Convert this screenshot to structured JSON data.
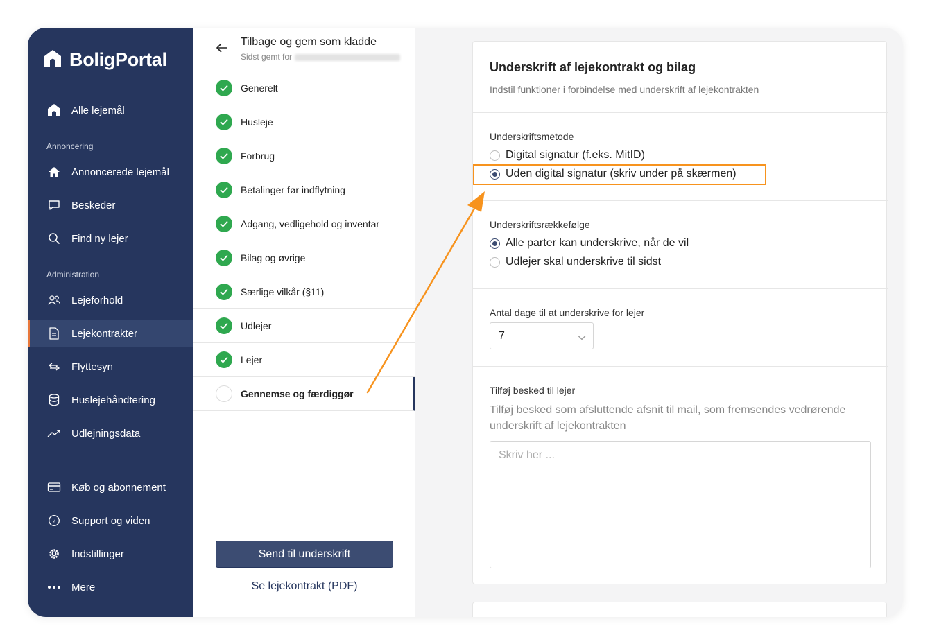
{
  "brand": {
    "name": "BoligPortal"
  },
  "sidebar": {
    "top_item": "Alle lejemål",
    "section_announcing": "Annoncering",
    "announcing_items": [
      "Annoncerede lejemål",
      "Beskeder",
      "Find ny lejer"
    ],
    "section_admin": "Administration",
    "admin_items": [
      "Lejeforhold",
      "Lejekontrakter",
      "Flyttesyn",
      "Huslejehåndtering",
      "Udlejningsdata"
    ],
    "bottom_items": [
      "Køb og abonnement",
      "Support og viden",
      "Indstillinger",
      "Mere"
    ],
    "active_item": "Lejekontrakter",
    "accent_color": "#e8773a"
  },
  "steps": {
    "back_title": "Tilbage og gem som kladde",
    "back_subtitle": "Sidst gemt for",
    "items": [
      "Generelt",
      "Husleje",
      "Forbrug",
      "Betalinger før indflytning",
      "Adgang, vedligehold og inventar",
      "Bilag og øvrige",
      "Særlige vilkår (§11)",
      "Udlejer",
      "Lejer",
      "Gennemse og færdiggør"
    ],
    "current": "Gennemse og færdiggør",
    "send_button": "Send til underskrift",
    "pdf_link": "Se lejekontrakt (PDF)"
  },
  "form": {
    "title": "Underskrift af lejekontrakt og bilag",
    "subtitle": "Indstil funktioner i forbindelse med underskrift af lejekontrakten",
    "method_label": "Underskriftsmetode",
    "method_options": [
      "Digital signatur (f.eks. MitID)",
      "Uden digital signatur (skriv under på skærmen)"
    ],
    "method_selected": 1,
    "order_label": "Underskriftsrækkefølge",
    "order_options": [
      "Alle parter kan underskrive, når de vil",
      "Udlejer skal underskrive til sidst"
    ],
    "order_selected": 0,
    "days_label": "Antal dage til at underskrive for lejer",
    "days_value": "7",
    "message_label": "Tilføj besked til lejer",
    "message_help": "Tilføj besked som afsluttende afsnit til mail, som fremsendes vedrørende underskrift af lejekontrakten",
    "message_placeholder": "Skriv her ..."
  }
}
